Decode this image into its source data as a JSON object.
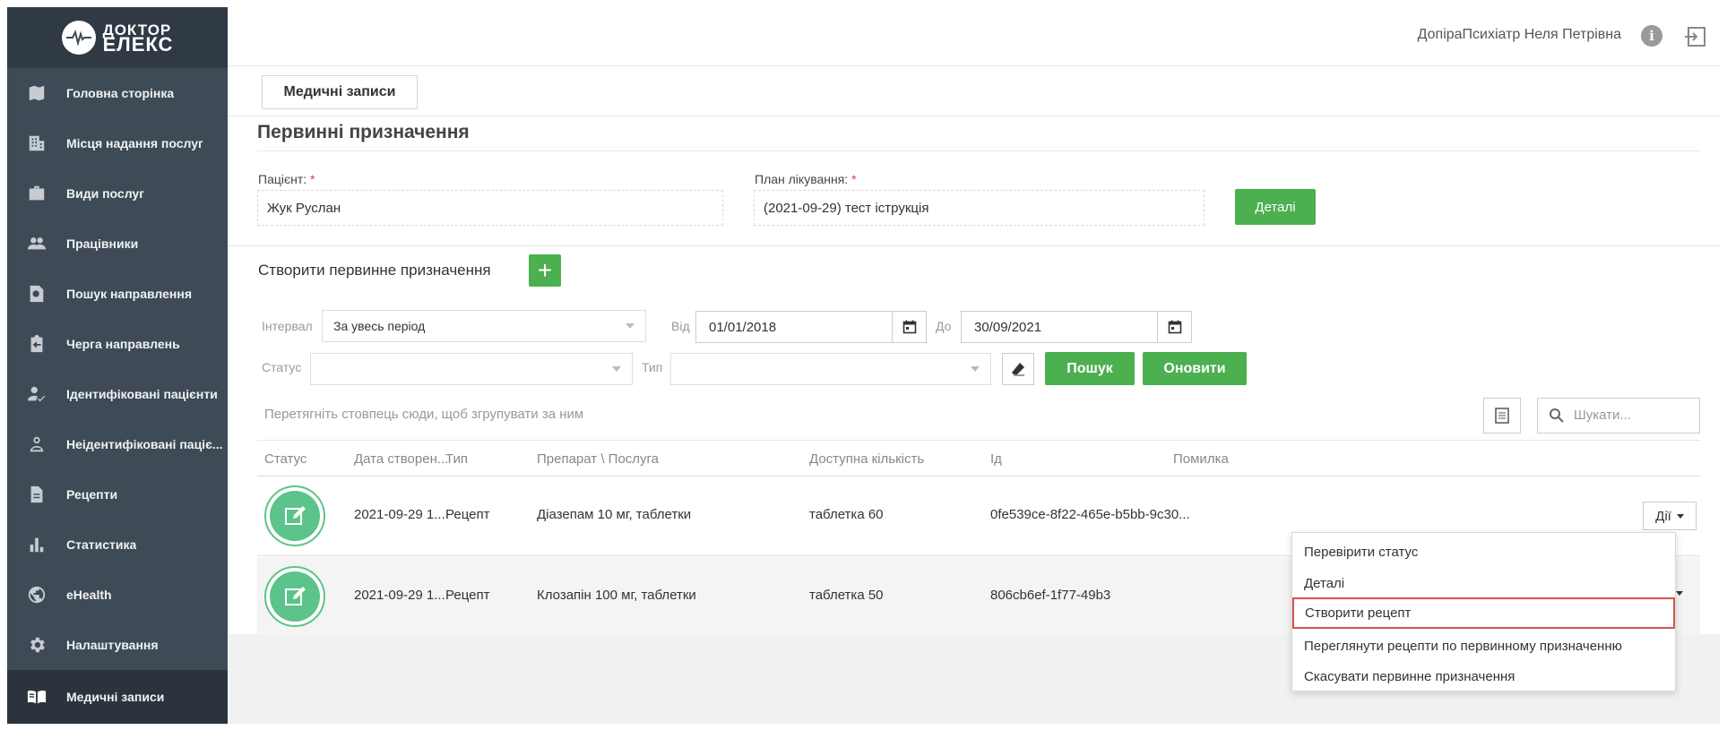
{
  "brand": {
    "line1": "ДОКТОР",
    "line2": "ЕЛЕКС"
  },
  "sidebar": {
    "items": [
      {
        "label": "Головна сторінка",
        "icon": "map-icon"
      },
      {
        "label": "Місця надання послуг",
        "icon": "building-icon"
      },
      {
        "label": "Види послуг",
        "icon": "briefcase-icon"
      },
      {
        "label": "Працівники",
        "icon": "people-icon"
      },
      {
        "label": "Пошук направлення",
        "icon": "search-document-icon"
      },
      {
        "label": "Черга направлень",
        "icon": "clipboard-arrow-icon"
      },
      {
        "label": "Ідентифіковані пацієнти",
        "icon": "user-check-icon"
      },
      {
        "label": "Неідентифіковані паціє...",
        "icon": "user-outline-icon"
      },
      {
        "label": "Рецепти",
        "icon": "document-icon"
      },
      {
        "label": "Статистика",
        "icon": "bar-chart-icon"
      },
      {
        "label": "eHealth",
        "icon": "globe-icon"
      },
      {
        "label": "Налаштування",
        "icon": "gear-icon"
      },
      {
        "label": "Медичні записи",
        "icon": "book-icon",
        "active": true
      }
    ]
  },
  "header": {
    "user_name": "ДопіраПсихіатр Неля Петрівна"
  },
  "tab": {
    "label": "Медичні записи"
  },
  "page": {
    "title": "Первинні призначення"
  },
  "form": {
    "patient_label": "Пацієнт:",
    "patient_value": "Жук Руслан",
    "plan_label": "План лікування:",
    "plan_value": "(2021-09-29) тест іструкція",
    "required_mark": "*",
    "details_button": "Деталі"
  },
  "create": {
    "label": "Створити первинне призначення",
    "plus": "+"
  },
  "filters": {
    "interval_label": "Інтервал",
    "interval_value": "За увесь період",
    "from_label": "Від",
    "from_value": "01/01/2018",
    "to_label": "До",
    "to_value": "30/09/2021",
    "status_label": "Статус",
    "status_value": "",
    "type_label": "Тип",
    "type_value": "",
    "search_button": "Пошук",
    "refresh_button": "Оновити"
  },
  "grid": {
    "group_hint": "Перетягніть стовпець сюди, щоб згрупувати за ним",
    "search_placeholder": "Шукати...",
    "columns": [
      "Статус",
      "Дата створен...",
      "Тип",
      "Препарат \\ Послуга",
      "Доступна кількість",
      "Ід",
      "Помилка"
    ],
    "rows": [
      {
        "date": "2021-09-29 1...",
        "type": "Рецепт",
        "item": "Діазепам 10 мг, таблетки",
        "qty": "таблетка 60",
        "id": "0fe539ce-8f22-465e-b5bb-9c30...",
        "error": ""
      },
      {
        "date": "2021-09-29 1...",
        "type": "Рецепт",
        "item": "Клозапін 100 мг, таблетки",
        "qty": "таблетка 50",
        "id": "806cb6ef-1f77-49b3",
        "error": ""
      }
    ],
    "actions_label": "Дії"
  },
  "dropdown": {
    "items": [
      "Перевірити статус",
      "Деталі",
      "Створити рецепт",
      "Переглянути рецепти по первинному призначенню",
      "Скасувати первинне призначення"
    ],
    "highlighted_index": 2
  },
  "colors": {
    "sidebar": "#3e4a56",
    "accent_green": "#4caf50",
    "highlight_red": "#d9534f"
  }
}
